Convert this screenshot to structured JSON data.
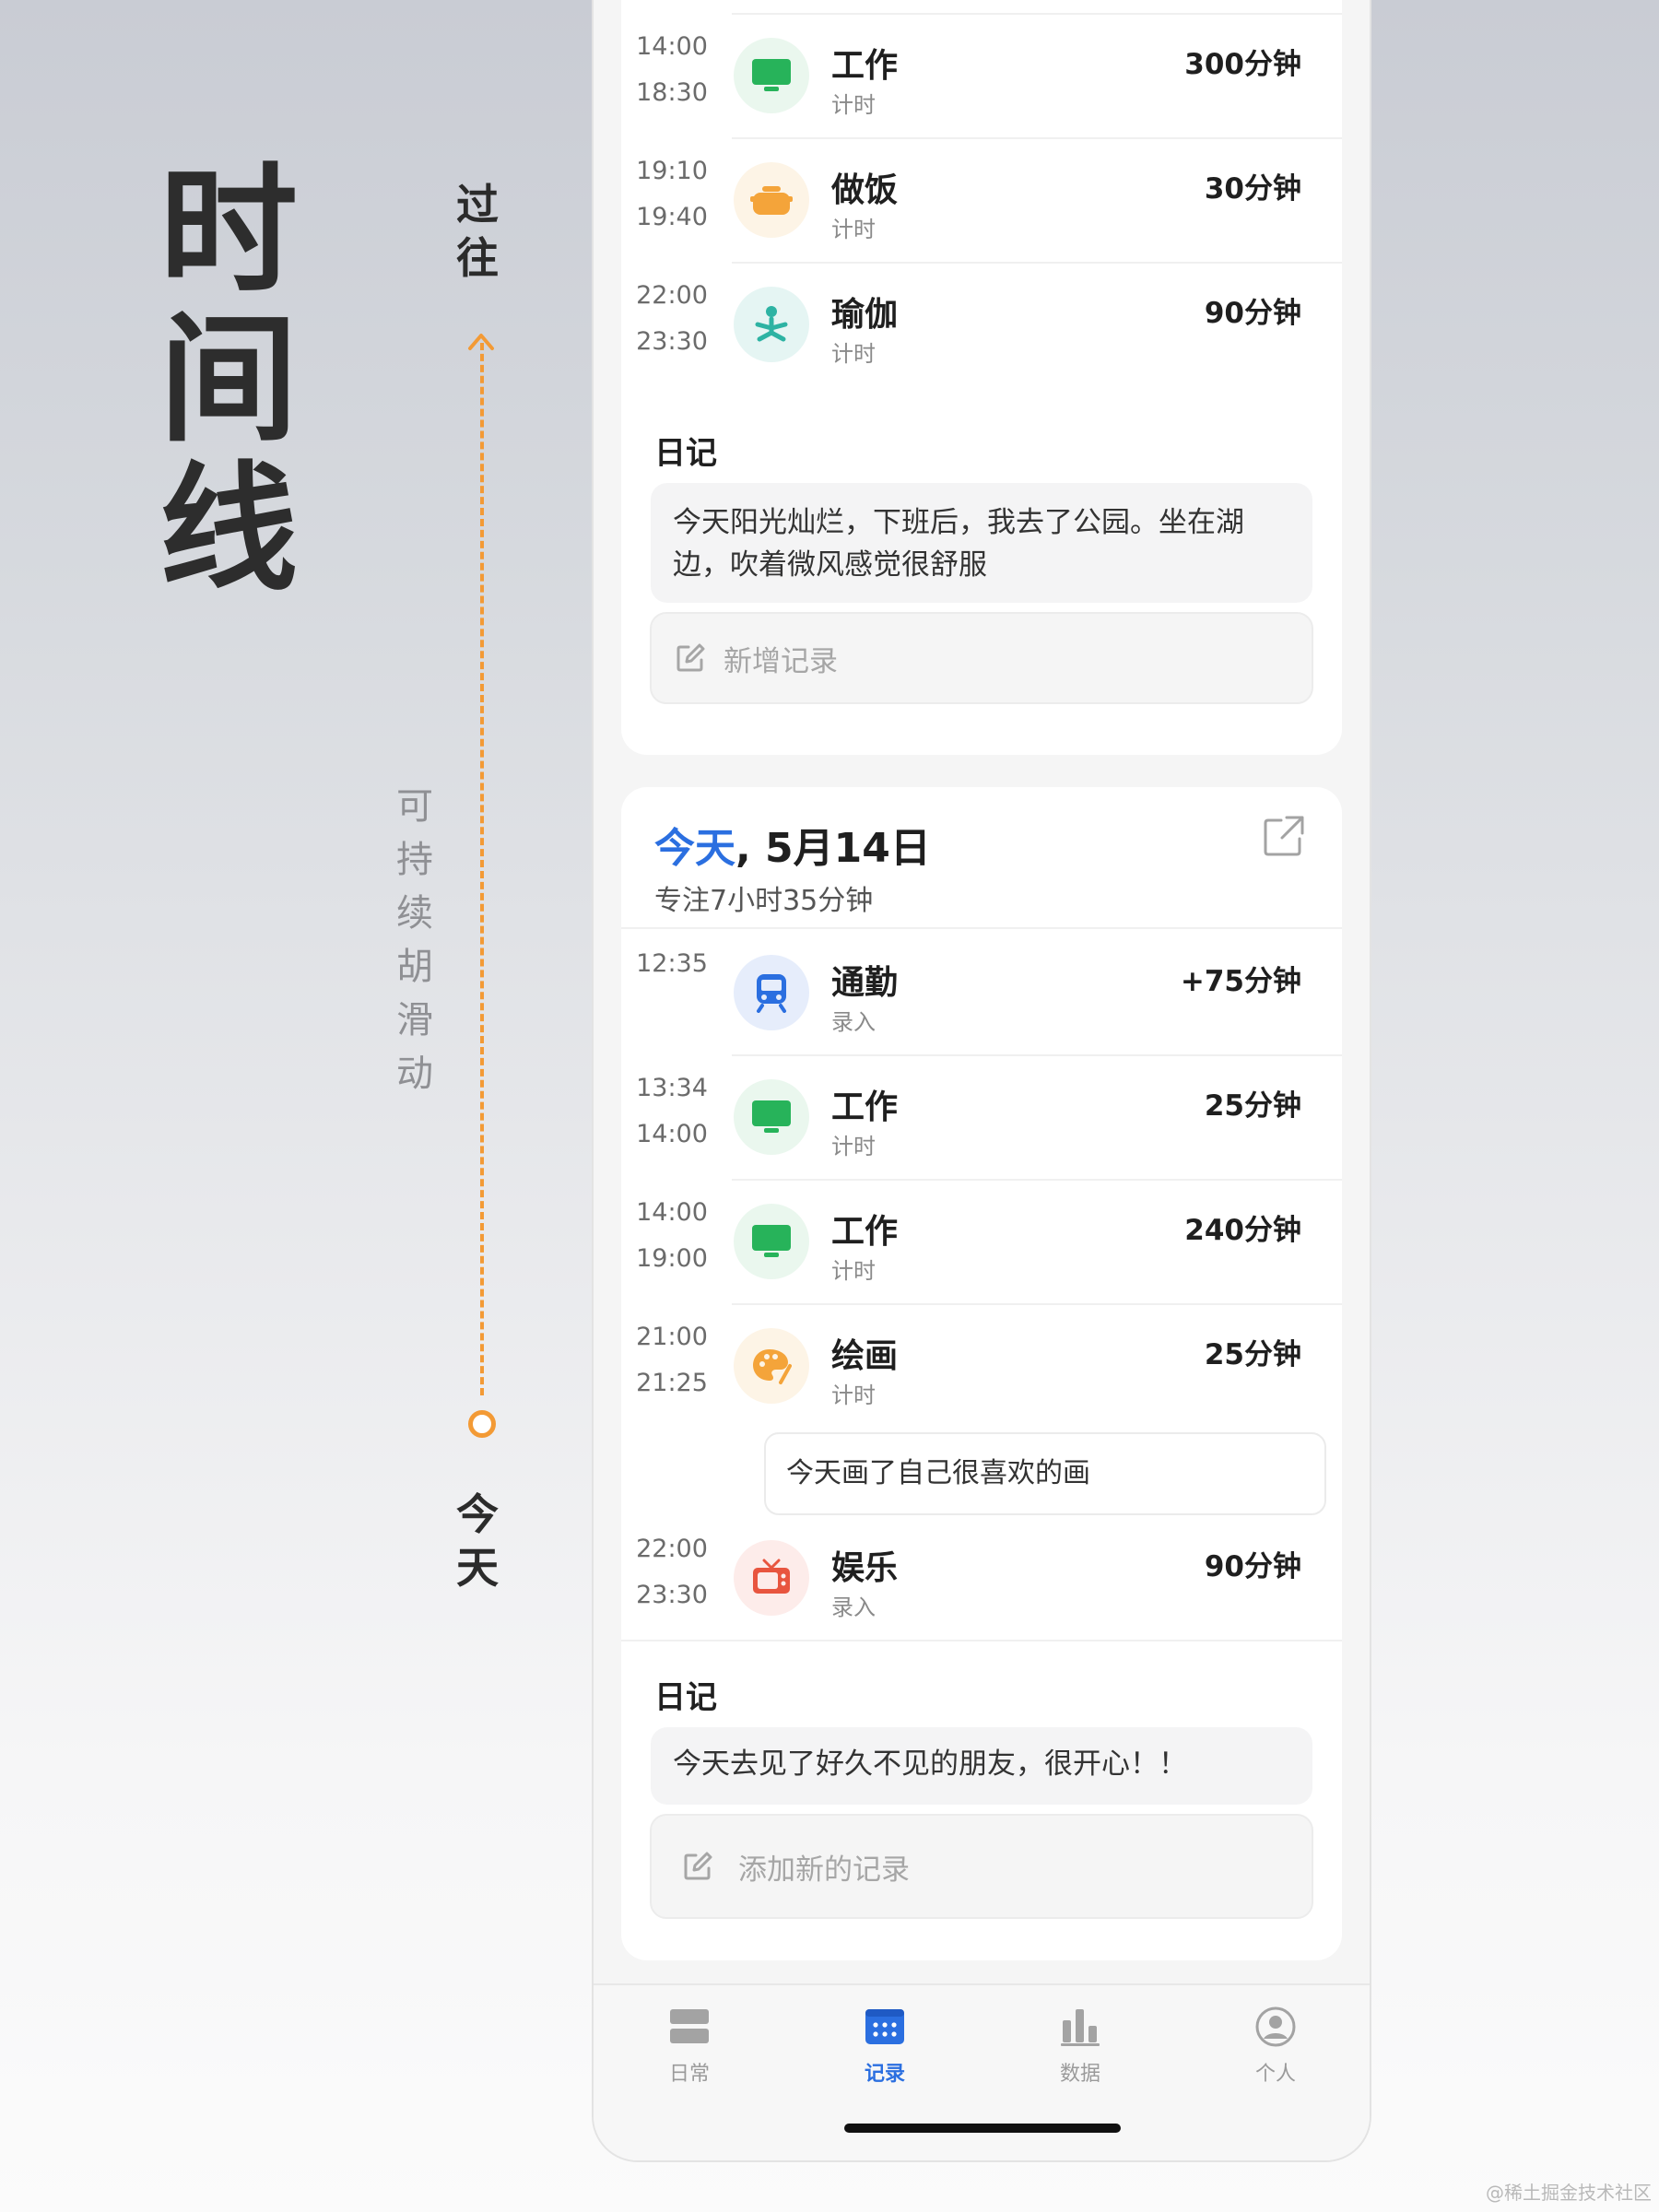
{
  "side": {
    "title_chars": [
      "时",
      "间",
      "线"
    ],
    "past_chars": [
      "过",
      "往"
    ],
    "scroll_chars": [
      "可",
      "持",
      "续",
      "胡",
      "滑",
      "动"
    ],
    "today_chars": [
      "今",
      "天"
    ],
    "accent_color": "#f39a35"
  },
  "past_card": {
    "entries": [
      {
        "start": "14:00",
        "end": "18:30",
        "name": "工作",
        "type": "计时",
        "duration": "300分钟",
        "icon": "monitor-icon"
      },
      {
        "start": "19:10",
        "end": "19:40",
        "name": "做饭",
        "type": "计时",
        "duration": "30分钟",
        "icon": "pot-icon"
      },
      {
        "start": "22:00",
        "end": "23:30",
        "name": "瑜伽",
        "type": "计时",
        "duration": "90分钟",
        "icon": "yoga-icon"
      }
    ],
    "diary_title": "日记",
    "diary_line1": "今天阳光灿烂，下班后，我去了公园。坐在湖",
    "diary_line2": "边，吹着微风感觉很舒服",
    "add_label": "新增记录"
  },
  "today_card": {
    "head_today": "今天",
    "head_date": ", 5月14日",
    "focus": "专注7小时35分钟",
    "entries": [
      {
        "start": "12:35",
        "end": "",
        "name": "通勤",
        "type": "录入",
        "duration": "+75分钟",
        "icon": "train-icon"
      },
      {
        "start": "13:34",
        "end": "14:00",
        "name": "工作",
        "type": "计时",
        "duration": "25分钟",
        "icon": "monitor-icon"
      },
      {
        "start": "14:00",
        "end": "19:00",
        "name": "工作",
        "type": "计时",
        "duration": "240分钟",
        "icon": "monitor-icon"
      },
      {
        "start": "21:00",
        "end": "21:25",
        "name": "绘画",
        "type": "计时",
        "duration": "25分钟",
        "icon": "palette-icon"
      },
      {
        "start": "22:00",
        "end": "23:30",
        "name": "娱乐",
        "type": "录入",
        "duration": "90分钟",
        "icon": "tv-icon"
      }
    ],
    "painting_note": "今天画了自己很喜欢的画",
    "diary_title": "日记",
    "diary_text": "今天去见了好久不见的朋友，很开心！！",
    "add_label": "添加新的记录"
  },
  "tabs": [
    {
      "label": "日常",
      "icon": "list-icon",
      "active": false
    },
    {
      "label": "记录",
      "icon": "calendar-icon",
      "active": true
    },
    {
      "label": "数据",
      "icon": "bar-chart-icon",
      "active": false
    },
    {
      "label": "个人",
      "icon": "user-icon",
      "active": false
    }
  ],
  "watermark": "@稀土掘金技术社区"
}
